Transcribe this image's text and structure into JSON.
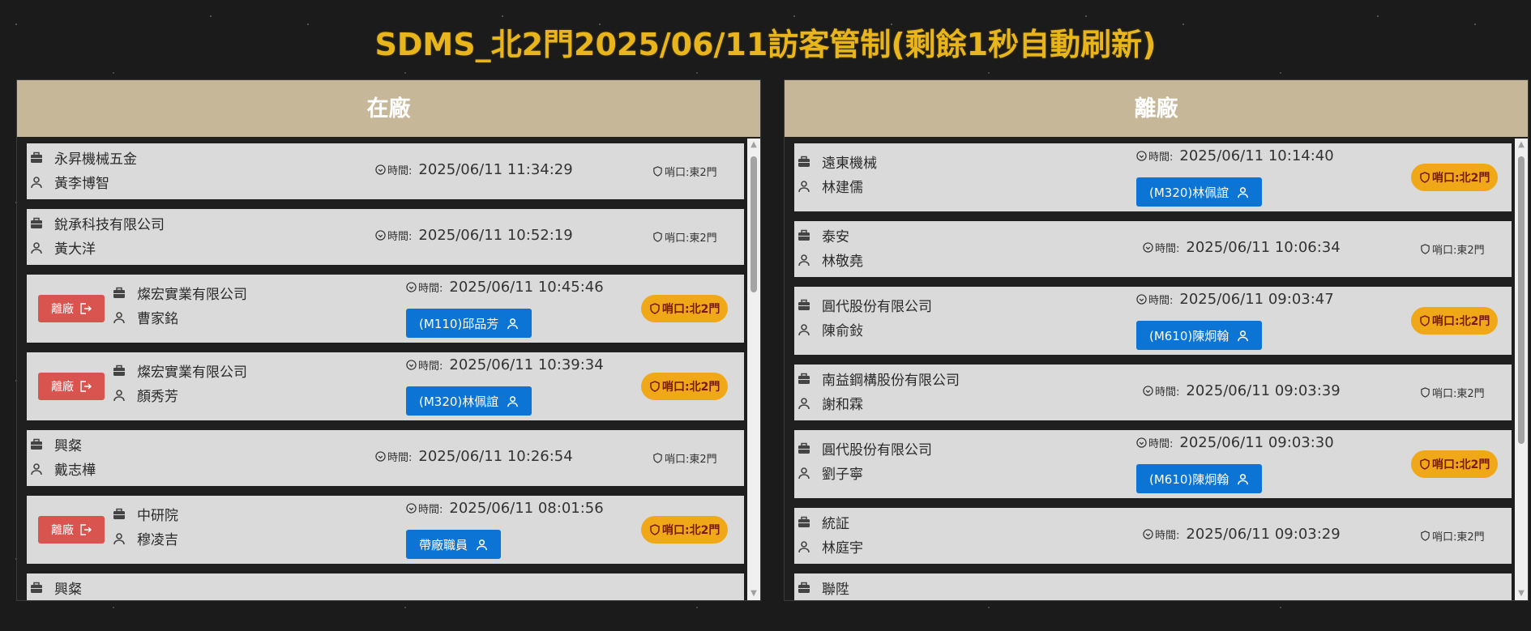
{
  "title": "SDMS_北2門2025/06/11訪客管制(剩餘1秒自動刷新)",
  "left_panel": {
    "header": "在廠",
    "leave_label": "離廠",
    "time_label": "時間:",
    "cards": [
      {
        "company": "永昇機械五金",
        "person": "黃李博智",
        "time": "2025/06/11 11:34:29",
        "gate": "哨口:東2門"
      },
      {
        "company": "銳承科技有限公司",
        "person": "黃大洋",
        "time": "2025/06/11 10:52:19",
        "gate": "哨口:東2門"
      },
      {
        "company": "燦宏實業有限公司",
        "person": "曹家銘",
        "time": "2025/06/11 10:45:46",
        "gate": "哨口:北2門",
        "host": "(M110)邱品芳"
      },
      {
        "company": "燦宏實業有限公司",
        "person": "顏秀芳",
        "time": "2025/06/11 10:39:34",
        "gate": "哨口:北2門",
        "host": "(M320)林佩誼"
      },
      {
        "company": "興粲",
        "person": "戴志樺",
        "time": "2025/06/11 10:26:54",
        "gate": "哨口:東2門"
      },
      {
        "company": "中研院",
        "person": "穆凌吉",
        "time": "2025/06/11 08:01:56",
        "gate": "哨口:北2門",
        "host": "帶廠職員"
      },
      {
        "company": "興粲"
      }
    ]
  },
  "right_panel": {
    "header": "離廠",
    "time_label": "時間:",
    "cards": [
      {
        "company": "遠東機械",
        "person": "林建儒",
        "time": "2025/06/11 10:14:40",
        "gate": "哨口:北2門",
        "host": "(M320)林佩誼"
      },
      {
        "company": "泰安",
        "person": "林敬堯",
        "time": "2025/06/11 10:06:34",
        "gate": "哨口:東2門"
      },
      {
        "company": "圓代股份有限公司",
        "person": "陳俞鈙",
        "time": "2025/06/11 09:03:47",
        "gate": "哨口:北2門",
        "host": "(M610)陳炯翰"
      },
      {
        "company": "南益鋼構股份有限公司",
        "person": "謝和霖",
        "time": "2025/06/11 09:03:39",
        "gate": "哨口:東2門"
      },
      {
        "company": "圓代股份有限公司",
        "person": "劉子寧",
        "time": "2025/06/11 09:03:30",
        "gate": "哨口:北2門",
        "host": "(M610)陳炯翰"
      },
      {
        "company": "統証",
        "person": "林庭宇",
        "time": "2025/06/11 09:03:29",
        "gate": "哨口:東2門"
      },
      {
        "company": "聯陞"
      }
    ]
  },
  "colors": {
    "accent": "#e8b51c",
    "header_bg": "#c7b799",
    "pill": "#f0a818",
    "host_btn": "#0b74d4",
    "leave_btn": "#d9534f"
  },
  "icons": [
    "briefcase-icon",
    "person-icon",
    "clock-icon",
    "shield-icon",
    "exit-icon"
  ]
}
